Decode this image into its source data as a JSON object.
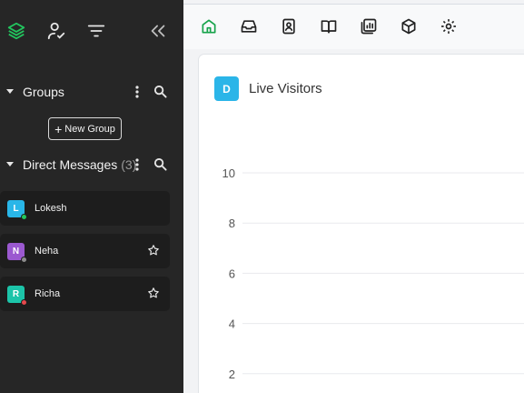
{
  "sidebar": {
    "toolbar_icons": [
      "layers-icon",
      "user-check-icon",
      "filter-icon",
      "collapse-double-chevron-icon"
    ],
    "groups": {
      "title": "Groups",
      "new_group_label": "New Group"
    },
    "direct_messages": {
      "title": "Direct Messages",
      "count": "(3)",
      "items": [
        {
          "initial": "L",
          "name": "Lokesh",
          "avatar_color": "#29b6e8",
          "status_color": "#22c55e",
          "starred": false
        },
        {
          "initial": "N",
          "name": "Neha",
          "avatar_color": "#9b59d0",
          "status_color": "#8c8c8c",
          "starred": true
        },
        {
          "initial": "R",
          "name": "Richa",
          "avatar_color": "#1cc4a9",
          "status_color": "#e5484d",
          "starred": true
        }
      ]
    }
  },
  "main": {
    "app_tabs": [
      "home-icon",
      "inbox-icon",
      "contacts-icon",
      "book-icon",
      "reports-icon",
      "package-icon",
      "settings-icon"
    ],
    "active_tab": "home-icon",
    "widget": {
      "badge": "D",
      "title": "Live Visitors"
    }
  },
  "chart_data": {
    "type": "line",
    "title": "Live Visitors",
    "y_ticks": [
      10,
      8,
      6,
      4,
      2
    ],
    "grid": true
  },
  "colors": {
    "sidebar_bg": "#262626",
    "accent": "#16a34a",
    "badge": "#2bb5e8"
  }
}
